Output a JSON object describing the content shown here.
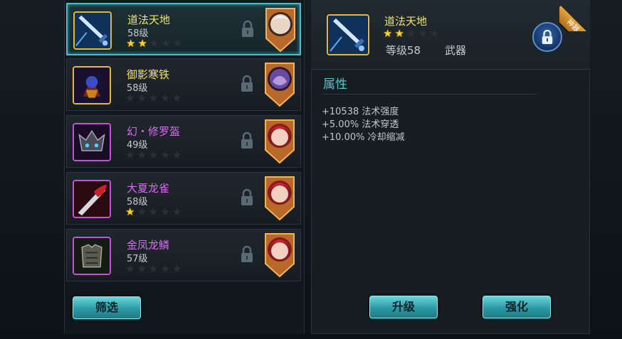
{
  "list": {
    "items": [
      {
        "name": "道法天地",
        "level": "58级",
        "stars": 2,
        "rarity": "gold",
        "selected": true
      },
      {
        "name": "御影寒铁",
        "level": "58级",
        "stars": 0,
        "rarity": "gold",
        "selected": false
      },
      {
        "name": "幻・修罗盔",
        "level": "49级",
        "stars": 0,
        "rarity": "purple",
        "selected": false
      },
      {
        "name": "大夏龙雀",
        "level": "58级",
        "stars": 1,
        "rarity": "purple",
        "selected": false
      },
      {
        "name": "金凤龙鳞",
        "level": "57级",
        "stars": 0,
        "rarity": "purple",
        "selected": false
      }
    ],
    "filter_label": "筛选"
  },
  "detail": {
    "name": "道法天地",
    "stars": 2,
    "level": "等级58",
    "type": "武器",
    "ribbon": "神器",
    "attr_title": "属性",
    "attributes": [
      "+10538 法术强度",
      "+5.00% 法术穿透",
      "+10.00% 冷却缩减"
    ],
    "upgrade_label": "升级",
    "enhance_label": "强化"
  },
  "colors": {
    "gold": "#f2e26a",
    "purple": "#d76cf0",
    "accent": "#4fb9c6",
    "star": "#ffd21f"
  }
}
